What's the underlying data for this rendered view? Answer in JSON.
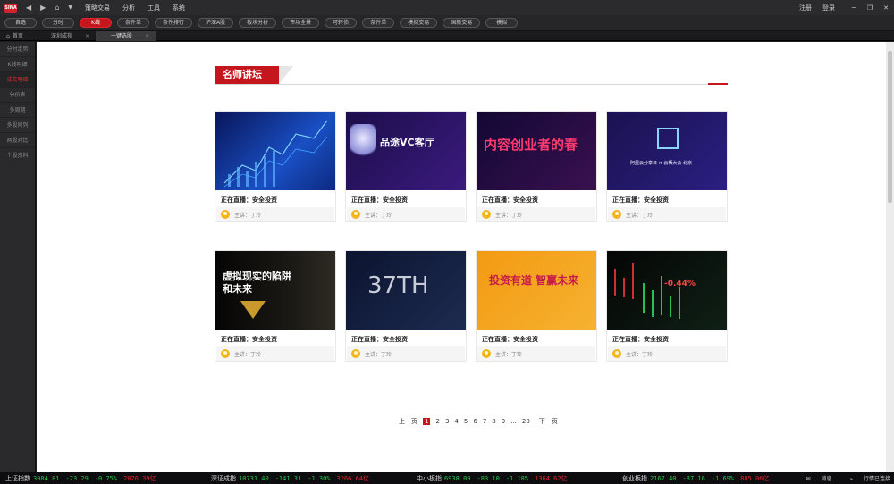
{
  "titlebar": {
    "logo": "SINA",
    "menu": [
      "策略交易",
      "分析",
      "工具",
      "系统"
    ],
    "right": [
      "注册",
      "登录"
    ]
  },
  "toolbar": {
    "pills": [
      "自选",
      "分时",
      "K线",
      "条件单",
      "条件排行",
      "沪深A股",
      "板块分析",
      "市场全景",
      "可转债",
      "条件单",
      "模拟交易",
      "国新交易",
      "模拟"
    ]
  },
  "tabs": {
    "home": "首页",
    "items": [
      "深圳成指",
      "一键选股"
    ]
  },
  "sidebar": {
    "items": [
      "分时走势",
      "K线明细",
      "成交明细",
      "分价表",
      "多周期",
      "多股同列",
      "两股对比",
      "个股资料"
    ]
  },
  "section": {
    "title": "名师讲坛"
  },
  "cards": [
    {
      "title": "正在直播：安全投资",
      "host": "主讲：丁玲",
      "thumb_text": "",
      "colors": [
        "#0a1a6a",
        "#1f5bd6"
      ]
    },
    {
      "title": "正在直播：安全投资",
      "host": "主讲：丁玲",
      "thumb_text": "品途VC客厅",
      "colors": [
        "#1c0e4a",
        "#3b1a7e"
      ]
    },
    {
      "title": "正在直播：安全投资",
      "host": "主讲：丁玲",
      "thumb_text": "内容创业者的春",
      "colors": [
        "#150a3a",
        "#3a1050"
      ]
    },
    {
      "title": "正在直播：安全投资",
      "host": "主讲：丁玲",
      "thumb_text": "阿里云分享日 × 云栖大会 北京",
      "colors": [
        "#1d1654",
        "#2a1f7a"
      ]
    },
    {
      "title": "正在直播：安全投资",
      "host": "主讲：丁玲",
      "thumb_text": "虚拟现实的陷阱和未来",
      "colors": [
        "#070707",
        "#2a2418"
      ]
    },
    {
      "title": "正在直播：安全投资",
      "host": "主讲：丁玲",
      "thumb_text": "37TH",
      "colors": [
        "#0c1530",
        "#1c2a4e"
      ]
    },
    {
      "title": "正在直播：安全投资",
      "host": "主讲：丁玲",
      "thumb_text": "投资有道 智赢未来",
      "colors": [
        "#f39a12",
        "#f6b231"
      ]
    },
    {
      "title": "正在直播：安全投资",
      "host": "主讲：丁玲",
      "thumb_text": "-0.44%",
      "colors": [
        "#0a0a0a",
        "#14261a"
      ]
    }
  ],
  "pager": {
    "prev": "上一页",
    "pages": [
      "1",
      "2",
      "3",
      "4",
      "5",
      "6",
      "7",
      "8",
      "9",
      "...",
      "20"
    ],
    "current": "1",
    "next": "下一页"
  },
  "ticker": [
    {
      "name": "上证指数",
      "value": "3084.81",
      "change": "-23.29",
      "pct": "-0.75%",
      "amount": "2076.39亿"
    },
    {
      "name": "深证成指",
      "value": "10731.40",
      "change": "-141.31",
      "pct": "-1.30%",
      "amount": "3266.64亿"
    },
    {
      "name": "中小板指",
      "value": "6938.09",
      "change": "-83.10",
      "pct": "-1.18%",
      "amount": "1364.62亿"
    },
    {
      "name": "创业板指",
      "value": "2167.40",
      "change": "-37.16",
      "pct": "-1.69%",
      "amount": "885.06亿"
    }
  ],
  "status": {
    "message": "消息",
    "connection": "行情已连接"
  },
  "colors": {
    "accent": "#c5161d",
    "down": "#26c34a",
    "amount": "#e0262d"
  }
}
